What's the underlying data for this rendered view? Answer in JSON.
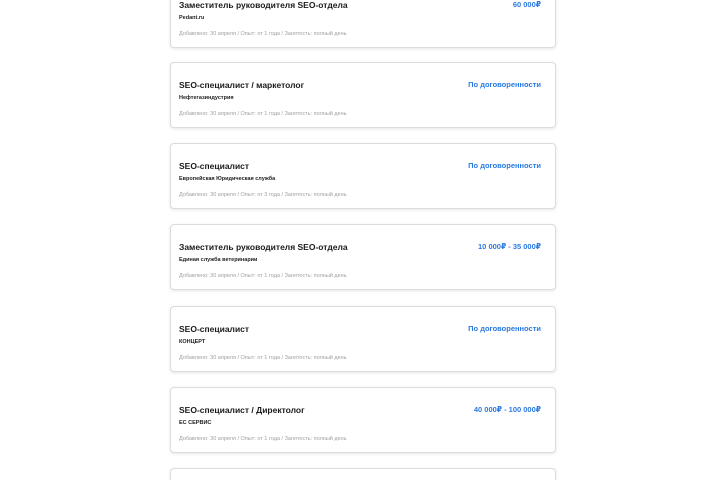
{
  "vacancies": [
    {
      "title": "Заместитель руководителя SEO-отдела",
      "company": "Pedant.ru",
      "meta": "Добавлено: 30 апреля / Опыт: от 1 года / Занятость: полный день",
      "salary": "60 000₽"
    },
    {
      "title": "SEO-специалист / маркетолог",
      "company": "Нефтегазиндустрия",
      "meta": "Добавлено: 30 апреля / Опыт: от 1 года / Занятость: полный день",
      "salary": "По договоренности"
    },
    {
      "title": "SEO-специалист",
      "company": "Европейская Юридическая служба",
      "meta": "Добавлено: 30 апреля / Опыт: от 3 года / Занятость: полный день",
      "salary": "По договоренности"
    },
    {
      "title": "Заместитель руководителя SEO-отдела",
      "company": "Единая служба ветеринарии",
      "meta": "Добавлено: 30 апреля / Опыт: от 1 года / Занятость: полный день",
      "salary": "10 000₽ - 35 000₽"
    },
    {
      "title": "SEO-специалист",
      "company": "КОНЦЕРТ",
      "meta": "Добавлено: 30 апреля / Опыт: от 1 года / Занятость: полный день",
      "salary": "По договоренности"
    },
    {
      "title": "SEO-специалист / Директолог",
      "company": "ЕС СЕРВИС",
      "meta": "Добавлено: 30 апреля / Опыт: от 1 года / Занятость: полный день",
      "salary": "40 000₽ - 100 000₽"
    }
  ],
  "colors": {
    "salary": "#2a7ae2",
    "border": "#dcdcdc",
    "meta_text": "#a0a0a0"
  }
}
